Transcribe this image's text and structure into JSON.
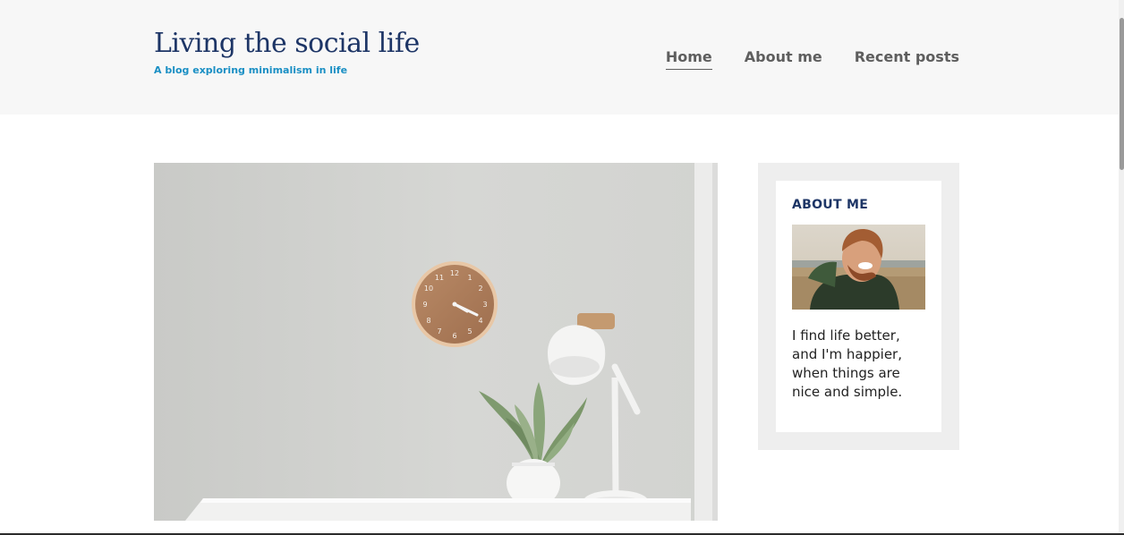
{
  "site": {
    "title": "Living the social life",
    "tagline": "A blog exploring minimalism in life"
  },
  "nav": {
    "items": [
      {
        "label": "Home",
        "active": true
      },
      {
        "label": "About me",
        "active": false
      },
      {
        "label": "Recent posts",
        "active": false
      }
    ]
  },
  "hero": {
    "icon": "minimal-room-photo"
  },
  "sidebar": {
    "widget_title": "ABOUT ME",
    "bio": "I find life better, and I'm happier, when things are nice and simple."
  },
  "colors": {
    "header_bg": "#f7f7f7",
    "title": "#1d3566",
    "tagline": "#1a8fc4",
    "nav_text": "#5e5e5e",
    "sidebar_bg": "#eeeeee"
  }
}
